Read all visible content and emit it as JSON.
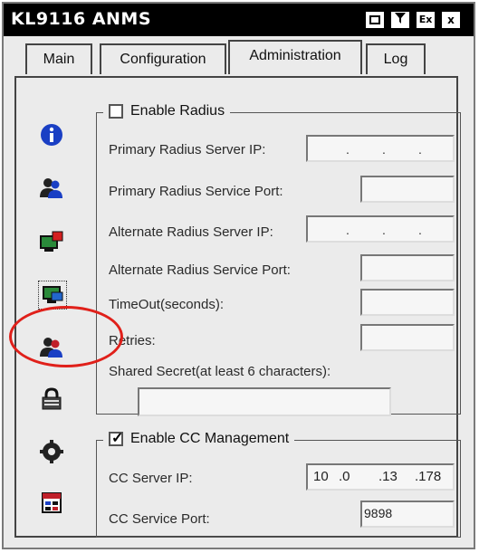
{
  "window": {
    "title": "KL9116 ANMS"
  },
  "title_buttons": [
    "",
    "",
    "Ex",
    "x"
  ],
  "tabs": [
    {
      "label": "Main",
      "active": false
    },
    {
      "label": "Configuration",
      "active": false
    },
    {
      "label": "Administration",
      "active": true
    },
    {
      "label": "Log",
      "active": false
    }
  ],
  "side_icons": [
    "info-icon",
    "users-icon",
    "network-alert-icon",
    "network-computer-icon",
    "radius-user-icon",
    "lock-icon",
    "gear-icon",
    "calendar-icon"
  ],
  "radius": {
    "enable_label": "Enable Radius",
    "enabled": false,
    "primary_ip_label": "Primary Radius Server IP:",
    "primary_port_label": "Primary Radius Service Port:",
    "alternate_ip_label": "Alternate Radius Server IP:",
    "alternate_port_label": "Alternate Radius Service Port:",
    "timeout_label": "TimeOut(seconds):",
    "retries_label": "Retries:",
    "shared_secret_label": "Shared Secret(at least 6 characters):",
    "ip_separator": ".",
    "primary_ip": "",
    "primary_port": "",
    "alternate_ip": "",
    "alternate_port": "",
    "timeout": "",
    "retries": "",
    "shared_secret": ""
  },
  "cc": {
    "enable_label": "Enable CC Management",
    "enabled": true,
    "server_ip_label": "CC Server IP:",
    "server_ip_octets": [
      "10",
      ".0",
      ".13",
      ".178"
    ],
    "service_port_label": "CC Service Port:",
    "service_port": "9898"
  },
  "colors": {
    "highlight": "#e0201a",
    "titlebar": "#000000"
  }
}
